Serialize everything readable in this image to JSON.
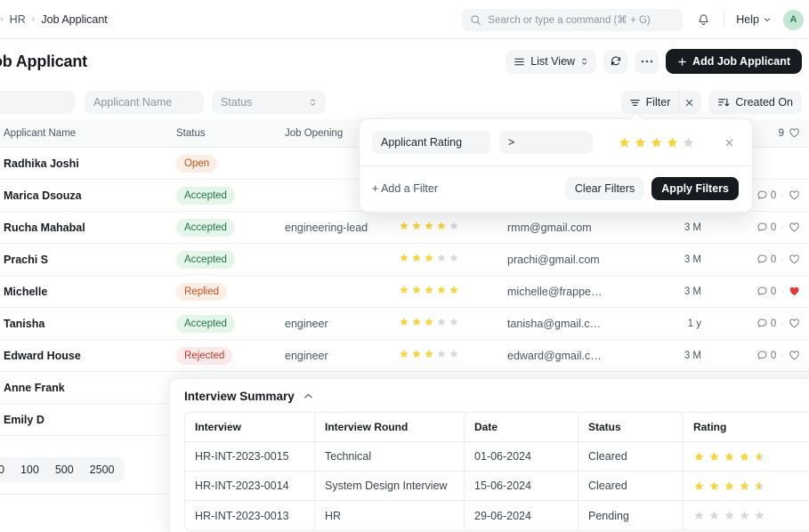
{
  "navbar": {
    "breadcrumb": [
      {
        "label": "HR"
      },
      {
        "label": "Job Applicant"
      }
    ],
    "search": {
      "placeholder": "Search or type a command (⌘ + G)"
    },
    "help_label": "Help",
    "avatar_initial": "A"
  },
  "page": {
    "title": "ob Applicant",
    "view_label": "List View",
    "more_label": "···",
    "add_label": "Add Job Applicant"
  },
  "toolbar": {
    "applicant_name_placeholder": "Applicant Name",
    "status_placeholder": "Status",
    "filter_label": "Filter",
    "sort_label": "Created On"
  },
  "filter_popup": {
    "field": "Applicant Rating",
    "operator": ">",
    "rating_value": 4,
    "rating_max": 5,
    "add_filter_label": "+ Add a Filter",
    "clear_label": "Clear Filters",
    "apply_label": "Apply Filters"
  },
  "table": {
    "columns": [
      "Applicant Name",
      "Status",
      "Job Opening",
      "",
      "",
      "",
      ""
    ],
    "header_count": "9",
    "rows": [
      {
        "name": "Radhika Joshi",
        "status": "Open",
        "status_kind": "open",
        "job": "",
        "rating": 0,
        "email": "",
        "modified": "",
        "comments": "",
        "liked": false,
        "show_meta": false
      },
      {
        "name": "Marica Dsouza",
        "status": "Accepted",
        "status_kind": "accepted",
        "job": "",
        "rating": 0,
        "email": "",
        "modified": "",
        "comments": "0",
        "liked": false,
        "show_meta": true
      },
      {
        "name": "Rucha Mahabal",
        "status": "Accepted",
        "status_kind": "accepted",
        "job": "engineering-lead",
        "rating": 4,
        "email": "rmm@gmail.com",
        "modified": "3 M",
        "comments": "0",
        "liked": false,
        "show_meta": true
      },
      {
        "name": "Prachi S",
        "status": "Accepted",
        "status_kind": "accepted",
        "job": "",
        "rating": 3,
        "email": "prachi@gmail.com",
        "modified": "3 M",
        "comments": "0",
        "liked": false,
        "show_meta": true
      },
      {
        "name": "Michelle",
        "status": "Replied",
        "status_kind": "replied",
        "job": "",
        "rating": 5,
        "email": "michelle@frappe…",
        "modified": "3 M",
        "comments": "0",
        "liked": true,
        "show_meta": true
      },
      {
        "name": "Tanisha",
        "status": "Accepted",
        "status_kind": "accepted",
        "job": "engineer",
        "rating": 3,
        "email": "tanisha@gmail.c…",
        "modified": "1 y",
        "comments": "0",
        "liked": false,
        "show_meta": true
      },
      {
        "name": "Edward House",
        "status": "Rejected",
        "status_kind": "rejected",
        "job": "engineer",
        "rating": 3,
        "email": "edward@gmail.c…",
        "modified": "3 M",
        "comments": "0",
        "liked": false,
        "show_meta": true
      },
      {
        "name": "Anne Frank",
        "status": "",
        "status_kind": "",
        "job": "",
        "rating": 0,
        "email": "",
        "modified": "",
        "comments": "",
        "liked": false,
        "show_meta": false
      },
      {
        "name": "Emily D",
        "status": "",
        "status_kind": "",
        "job": "",
        "rating": 0,
        "email": "",
        "modified": "",
        "comments": "",
        "liked": false,
        "show_meta": false
      }
    ]
  },
  "pagination": {
    "options": [
      "0",
      "100",
      "500",
      "2500"
    ]
  },
  "interview_summary": {
    "title": "Interview Summary",
    "columns": [
      "Interview",
      "Interview Round",
      "Date",
      "Status",
      "Rating"
    ],
    "rows": [
      {
        "interview": "HR-INT-2023-0015",
        "round": "Technical",
        "date": "01-06-2024",
        "status": "Cleared",
        "rating": 4.5
      },
      {
        "interview": "HR-INT-2023-0014",
        "round": "System Design Interview",
        "date": "15-06-2024",
        "status": "Cleared",
        "rating": 4.5
      },
      {
        "interview": "HR-INT-2023-0013",
        "round": "HR",
        "date": "29-06-2024",
        "status": "Pending",
        "rating": 0
      }
    ]
  },
  "colors": {
    "star_active": "#F5D547",
    "star_inactive": "#D8DADC",
    "primary_dark": "#171B1F",
    "accent_green": "#26734A",
    "accent_red": "#C0392B",
    "accent_orange": "#C4501A",
    "heart_red": "#E03A3A"
  }
}
